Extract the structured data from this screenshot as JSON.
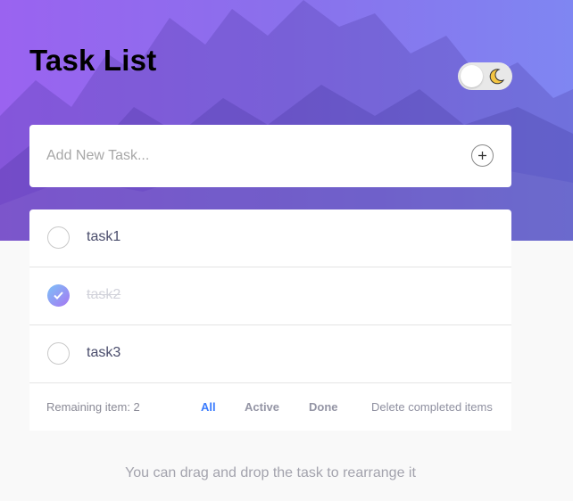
{
  "header": {
    "title": "Task List",
    "theme_toggle_icon": "moon-icon"
  },
  "new_task": {
    "placeholder": "Add New Task...",
    "add_icon": "plus-icon"
  },
  "tasks": [
    {
      "label": "task1",
      "completed": false
    },
    {
      "label": "task2",
      "completed": true
    },
    {
      "label": "task3",
      "completed": false
    }
  ],
  "footer": {
    "remaining": "Remaining item: 2",
    "filters": [
      "All",
      "Active",
      "Done"
    ],
    "selected_filter": "All",
    "clear_label": "Delete completed items"
  },
  "hint": "You can drag and drop the task to rearrange it",
  "colors": {
    "accent": "#3a7bfd",
    "hero_start": "#9a63f0",
    "hero_end": "#7f86f2",
    "check_gradient_start": "#7cc2f7",
    "check_gradient_end": "#a676f2"
  }
}
